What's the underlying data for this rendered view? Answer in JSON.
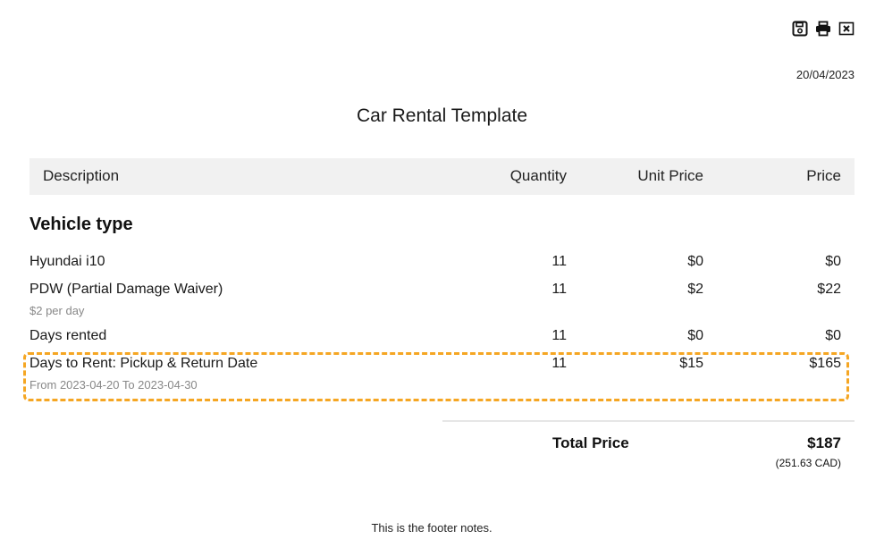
{
  "toolbar": {
    "icons": [
      "save-icon",
      "print-icon",
      "close-icon"
    ]
  },
  "document": {
    "date": "20/04/2023",
    "title": "Car Rental Template",
    "section_title": "Vehicle type",
    "footer": "This is the footer notes."
  },
  "table": {
    "headers": {
      "description": "Description",
      "quantity": "Quantity",
      "unit_price": "Unit Price",
      "price": "Price"
    },
    "rows": [
      {
        "description": "Hyundai i10",
        "sub": "",
        "quantity": "11",
        "unit_price": "$0",
        "price": "$0"
      },
      {
        "description": "PDW (Partial Damage Waiver)",
        "sub": "$2 per day",
        "quantity": "11",
        "unit_price": "$2",
        "price": "$22"
      },
      {
        "description": "Days rented",
        "sub": "",
        "quantity": "11",
        "unit_price": "$0",
        "price": "$0"
      },
      {
        "description": "Days to Rent: Pickup & Return Date",
        "sub": "From 2023-04-20 To 2023-04-30",
        "quantity": "11",
        "unit_price": "$15",
        "price": "$165",
        "highlighted": true
      }
    ]
  },
  "totals": {
    "label": "Total Price",
    "value": "$187",
    "converted": "(251.63 CAD)"
  },
  "colors": {
    "highlight_border": "#f5a623",
    "header_bg": "#f1f1f1",
    "sub_text": "#888888"
  }
}
